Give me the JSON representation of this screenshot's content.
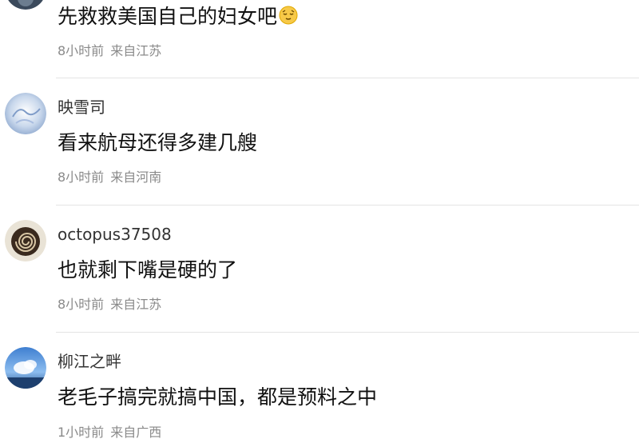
{
  "comments": [
    {
      "username": "",
      "content": "先救救美国自己的妇女吧",
      "emoji": "sleeping-face-emoji",
      "time": "8小时前",
      "location": "来自江苏"
    },
    {
      "username": "映雪司",
      "content": "看来航母还得多建几艘",
      "time": "8小时前",
      "location": "来自河南"
    },
    {
      "username": "octopus37508",
      "content": "也就剩下嘴是硬的了",
      "time": "8小时前",
      "location": "来自江苏"
    },
    {
      "username": "柳江之畔",
      "content": "老毛子搞完就搞中国，都是预料之中",
      "time": "1小时前",
      "location": "来自广西"
    }
  ],
  "colors": {
    "username": "#333333",
    "content": "#111111",
    "meta": "#8a8a8a",
    "divider": "#e4e4e4"
  }
}
